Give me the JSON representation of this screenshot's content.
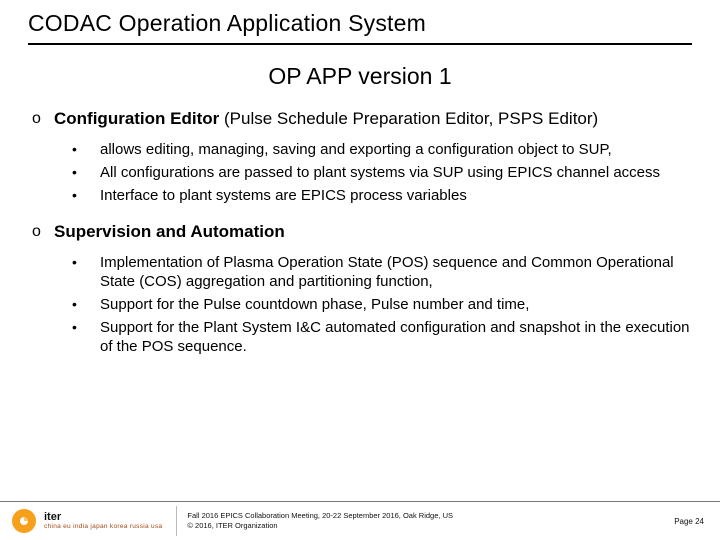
{
  "title": "CODAC Operation Application System",
  "subtitle": "OP APP version 1",
  "sections": [
    {
      "marker": "o",
      "heading_bold": "Configuration Editor",
      "heading_rest": " (Pulse Schedule Preparation Editor, PSPS Editor)",
      "bullets": [
        "allows editing, managing, saving and exporting a configuration object to SUP,",
        "All configurations are passed to plant systems via SUP using EPICS channel access",
        "Interface to plant systems are EPICS process variables"
      ]
    },
    {
      "marker": "o",
      "heading_bold": "Supervision and Automation",
      "heading_rest": "",
      "bullets": [
        "Implementation of Plasma Operation State (POS) sequence and Common Operational State (COS) aggregation and partitioning function,",
        "Support for the Pulse countdown phase, Pulse number and time,",
        "Support for the Plant System I&C automated configuration and snapshot in the execution of the POS sequence."
      ]
    }
  ],
  "footer": {
    "logo_name": "iter",
    "tagline": "china eu india japan korea russia usa",
    "line1": "Fall 2016 EPICS Collaboration Meeting, 20-22 September 2016, Oak Ridge, US",
    "line2": "© 2016, ITER Organization",
    "page": "Page 24"
  }
}
